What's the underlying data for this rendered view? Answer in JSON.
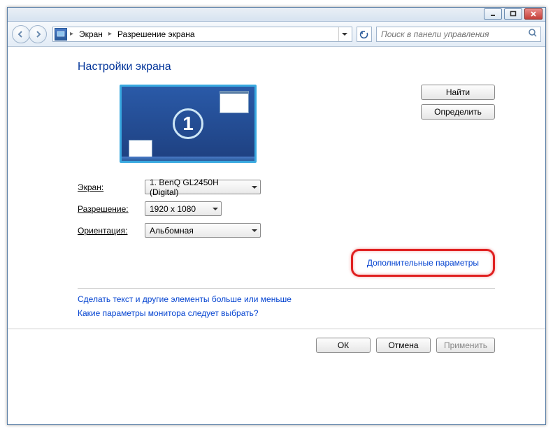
{
  "breadcrumb": {
    "seg1": "Экран",
    "seg2": "Разрешение экрана"
  },
  "search": {
    "placeholder": "Поиск в панели управления"
  },
  "page": {
    "title": "Настройки экрана"
  },
  "monitor": {
    "number": "1"
  },
  "side_buttons": {
    "find": "Найти",
    "detect": "Определить"
  },
  "fields": {
    "screen_label": "Экран:",
    "screen_value": "1. BenQ GL2450H (Digital)",
    "resolution_label": "Разрешение:",
    "resolution_value": "1920 x 1080",
    "orientation_label": "Ориентация:",
    "orientation_value": "Альбомная"
  },
  "links": {
    "advanced": "Дополнительные параметры",
    "text_size": "Сделать текст и другие элементы больше или меньше",
    "which_settings": "Какие параметры монитора следует выбрать?"
  },
  "buttons": {
    "ok": "ОК",
    "cancel": "Отмена",
    "apply": "Применить"
  }
}
